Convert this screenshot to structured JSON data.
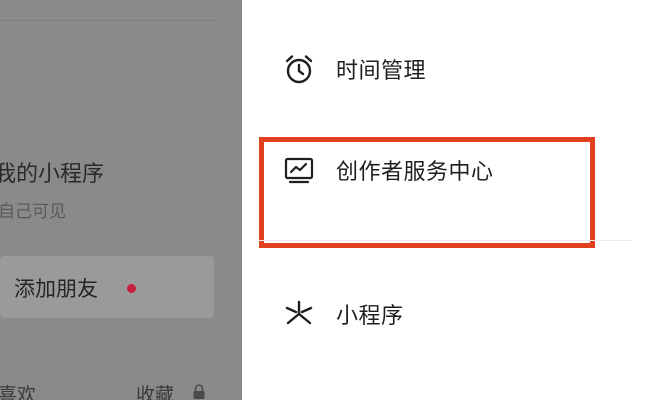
{
  "background_page": {
    "mini_program_title": "我的小程序",
    "mini_program_sub": "自己可见",
    "add_friend_label": "添加朋友",
    "tab_left": "喜欢",
    "tab_right": "收藏"
  },
  "drawer": {
    "items": [
      {
        "icon": "alarm-clock-icon",
        "label": "时间管理"
      },
      {
        "icon": "creator-chart-icon",
        "label": "创作者服务中心"
      },
      {
        "icon": "mini-program-icon",
        "label": "小程序"
      }
    ]
  },
  "colors": {
    "highlight_border": "#e2401f",
    "notification_dot": "#c7203d"
  }
}
